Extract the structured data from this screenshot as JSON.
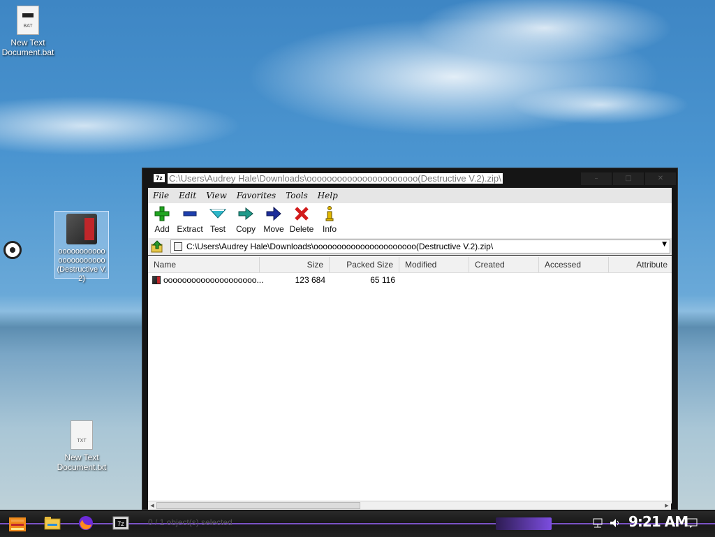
{
  "desktop": {
    "icons": [
      {
        "label": "New Text Document.bat",
        "type_tag": "BAT"
      },
      {
        "label": "oooooooooooooooooooooo(Destructive V.2)"
      },
      {
        "label": "New Text Document.txt",
        "type_tag": "TXT"
      }
    ]
  },
  "window": {
    "title": "C:\\Users\\Audrey Hale\\Downloads\\oooooooooooooooooooooo(Destructive V.2).zip\\",
    "app_badge": "7z",
    "menu": [
      "File",
      "Edit",
      "View",
      "Favorites",
      "Tools",
      "Help"
    ],
    "toolbar": [
      {
        "label": "Add",
        "icon": "plus-icon",
        "color": "#1fa51f"
      },
      {
        "label": "Extract",
        "icon": "minus-icon",
        "color": "#1e3fae"
      },
      {
        "label": "Test",
        "icon": "check-chevron-icon",
        "color": "#2fb7c9"
      },
      {
        "label": "Copy",
        "icon": "arrow-right-double-icon",
        "color": "#1f9a8a"
      },
      {
        "label": "Move",
        "icon": "arrow-right-icon",
        "color": "#1c2d9a"
      },
      {
        "label": "Delete",
        "icon": "x-icon",
        "color": "#d21c1c"
      },
      {
        "label": "Info",
        "icon": "info-icon",
        "color": "#e2b800"
      }
    ],
    "address": "C:\\Users\\Audrey Hale\\Downloads\\oooooooooooooooooooooo(Destructive V.2).zip\\",
    "columns": [
      "Name",
      "Size",
      "Packed Size",
      "Modified",
      "Created",
      "Accessed",
      "Attribute"
    ],
    "rows": [
      {
        "name": "oooooooooooooooooooo...",
        "size": "123 684",
        "packed_size": "65 116",
        "modified": "",
        "created": "",
        "accessed": "",
        "attributes": ""
      }
    ],
    "status": "0 / 1 object(s) selected"
  },
  "taskbar": {
    "clock": "9:21 AM"
  }
}
